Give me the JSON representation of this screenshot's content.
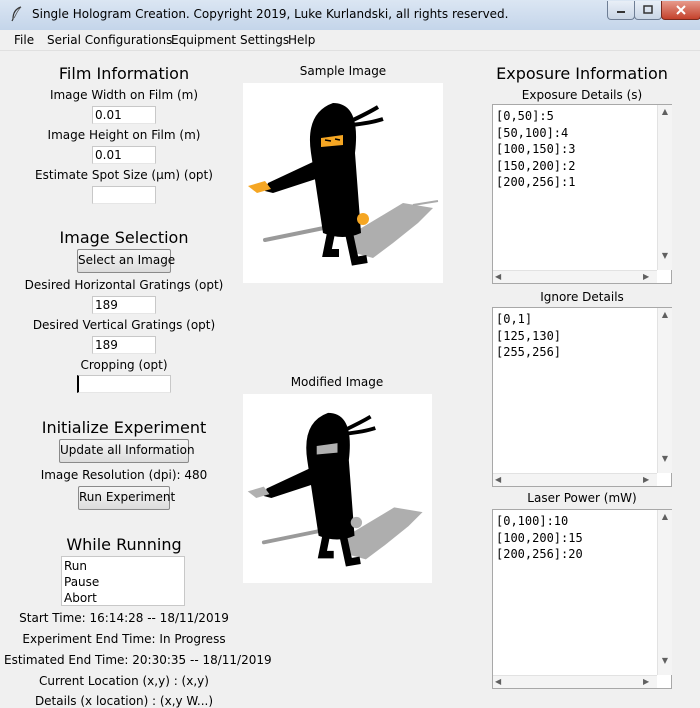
{
  "window": {
    "title": "Single Hologram Creation. Copyright 2019, Luke Kurlandski, all rights reserved."
  },
  "menu": [
    "File",
    "Serial Configurations",
    "Equipment Settings",
    "Help"
  ],
  "film": {
    "header": "Film Information",
    "width_label": "Image Width on Film (m)",
    "width_value": "0.01",
    "height_label": "Image Height on Film (m)",
    "height_value": "0.01",
    "spot_label": "Estimate Spot Size (µm) (opt)",
    "spot_value": ""
  },
  "selection": {
    "header": "Image Selection",
    "select_button": "Select an Image",
    "horiz_label": "Desired Horizontal Gratings (opt)",
    "horiz_value": "189",
    "vert_label": "Desired Vertical Gratings (opt)",
    "vert_value": "189",
    "crop_label": "Cropping (opt)",
    "crop_value": ""
  },
  "experiment": {
    "header": "Initialize Experiment",
    "update_button": "Update all Information",
    "resolution_label": "Image Resolution (dpi): 480",
    "run_button": "Run Experiment"
  },
  "running": {
    "header": "While Running",
    "options": [
      "Run",
      "Pause",
      "Abort"
    ],
    "start_time": "Start Time: 16:14:28 -- 18/11/2019",
    "end_time": "Experiment End Time: In Progress",
    "estimated_end": "Estimated End Time: 20:30:35 -- 18/11/2019",
    "current_location": "Current Location (x,y) : (x,y)",
    "details": "Details (x location) : (x,y W...)"
  },
  "images": {
    "sample_label": "Sample Image",
    "modified_label": "Modified Image"
  },
  "exposure": {
    "header": "Exposure Information",
    "details_label": "Exposure Details (s)",
    "details_lines": [
      "[0,50]:5",
      "[50,100]:4",
      "[100,150]:3",
      "[150,200]:2",
      "[200,256]:1"
    ],
    "ignore_label": "Ignore Details",
    "ignore_lines": [
      "[0,1]",
      "[125,130]",
      "[255,256]"
    ],
    "laser_label": "Laser Power (mW)",
    "laser_lines": [
      "[0,100]:10",
      "[100,200]:15",
      "[200,256]:20"
    ]
  },
  "icons": {
    "app": "feather-icon",
    "minimize": "minimize-icon",
    "maximize": "maximize-icon",
    "close": "close-icon"
  },
  "colors": {
    "titlebar": "#c4d5ea",
    "close_button": "#c4422c",
    "background": "#f0f0f0",
    "ninja_mask": "#f5a623"
  }
}
